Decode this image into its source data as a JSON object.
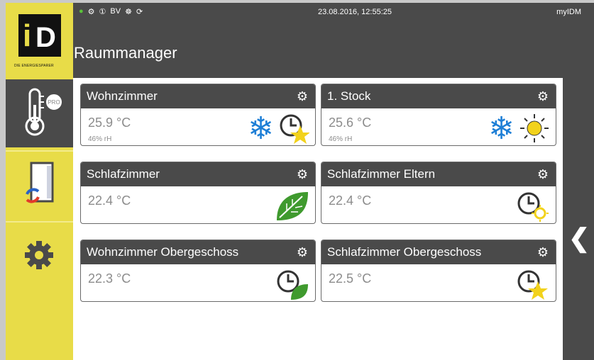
{
  "statusbar": {
    "datetime": "23.08.2016, 12:55:25",
    "user": "myIDM",
    "icons": [
      "info-icon",
      "tap-icon",
      "circle-1-icon",
      "bv-icon",
      "heatpump-icon",
      "sync-icon"
    ]
  },
  "logo": {
    "subtitle": "DIE ENERGIESPARER"
  },
  "header": {
    "title": "Raummanager"
  },
  "sidebar": {
    "items": [
      {
        "name": "thermostat-pro",
        "badge": "PRO"
      },
      {
        "name": "door-exchange"
      },
      {
        "name": "settings"
      }
    ]
  },
  "rooms": [
    {
      "name": "Wohnzimmer",
      "temp": "25.9 °C",
      "rh": "46% rH",
      "mode": "cool",
      "program": "timer-star"
    },
    {
      "name": "1. Stock",
      "temp": "25.6 °C",
      "rh": "46% rH",
      "mode": "cool",
      "program": "sun"
    },
    {
      "name": "Schlafzimmer",
      "temp": "22.4 °C",
      "rh": "",
      "mode": "eco",
      "program": ""
    },
    {
      "name": "Schlafzimmer Eltern",
      "temp": "22.4 °C",
      "rh": "",
      "mode": "",
      "program": "timer-sun"
    },
    {
      "name": "Wohnzimmer Obergeschoss",
      "temp": "22.3 °C",
      "rh": "",
      "mode": "",
      "program": "timer-leaf"
    },
    {
      "name": "Schlafzimmer Obergeschoss",
      "temp": "22.5 °C",
      "rh": "",
      "mode": "",
      "program": "timer-star"
    }
  ],
  "colors": {
    "accent": "#e8dc48",
    "dark": "#4a4a4a",
    "cool": "#1e7fd6",
    "eco": "#3f9a2e",
    "star": "#f2d21b"
  }
}
